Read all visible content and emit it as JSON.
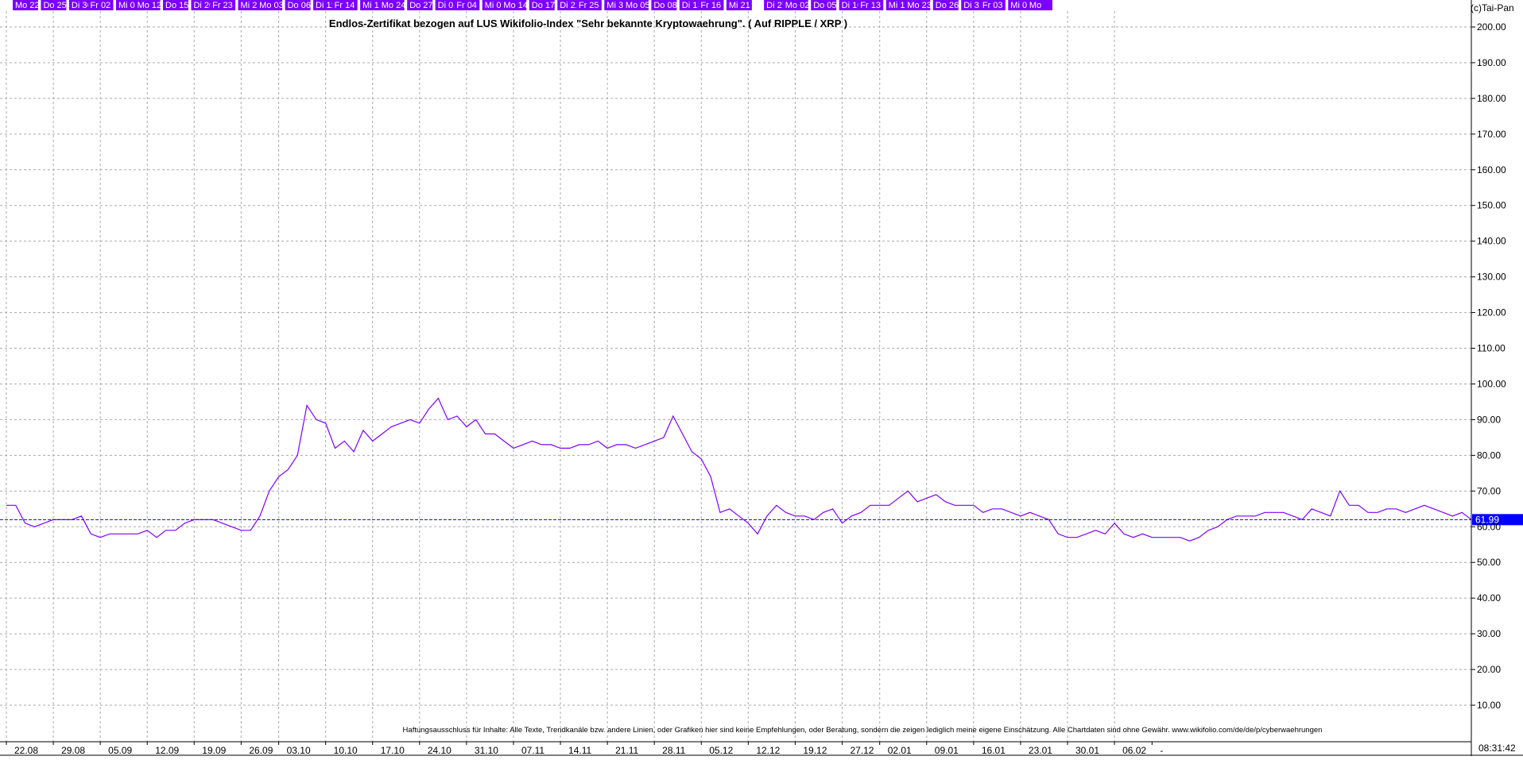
{
  "chart_data": {
    "type": "line",
    "title": "Endlos-Zertifikat bezogen auf LUS Wikifolio-Index \"Sehr bekannte Kryptowaehrung\". ( Auf RIPPLE / XRP )",
    "copyright": "(c)Tai-Pan",
    "disclaimer": "Haftungsausschluss für Inhalte: Alle Texte, Trendkanäle bzw. andere Linien, oder Grafiken hier sind keine Empfehlungen, oder Beratung, sondern die zeigen lediglich meine eigene Einschätzung. Alle Chartdaten sind ohne Gewähr. www.wikifolio.com/de/de/p/cyberwaehrungen",
    "time_label": "08:31:42",
    "ylim": [
      0,
      210
    ],
    "y_ticks": [
      "10.00",
      "20.00",
      "30.00",
      "40.00",
      "50.00",
      "60.00",
      "70.00",
      "80.00",
      "90.00",
      "100.00",
      "110.00",
      "120.00",
      "130.00",
      "140.00",
      "150.00",
      "160.00",
      "170.00",
      "180.00",
      "190.00",
      "200.00"
    ],
    "y_tick_values": [
      10,
      20,
      30,
      40,
      50,
      60,
      70,
      80,
      90,
      100,
      110,
      120,
      130,
      140,
      150,
      160,
      170,
      180,
      190,
      200
    ],
    "x_dates": [
      "22.08",
      "29.08",
      "05.09",
      "12.09",
      "19.09",
      "26.09",
      "03.10",
      "10.10",
      "17.10",
      "24.10",
      "31.10",
      "07.11",
      "14.11",
      "21.11",
      "28.11",
      "05.12",
      "12.12",
      "19.12",
      "27.12",
      "02.01",
      "09.01",
      "16.01",
      "23.01",
      "30.01",
      "06.02",
      "-"
    ],
    "x_date_index": [
      0,
      5,
      10,
      15,
      20,
      25,
      29,
      34,
      39,
      44,
      49,
      54,
      59,
      64,
      69,
      74,
      79,
      84,
      89,
      93,
      98,
      103,
      108,
      113,
      118,
      122
    ],
    "x_days": [
      "Mo 22",
      "Do 25",
      "Di 30",
      "Fr 02",
      "Mi 07",
      "Mo 12",
      "Do 15",
      "Di 20",
      "Fr 23",
      "Mi 28",
      "Mo 03",
      "Do 06",
      "Di 11",
      "Fr 14",
      "Mi 19",
      "Mo 24",
      "Do 27",
      "Di 01",
      "Fr 04",
      "Mi 09",
      "Mo 14",
      "Do 17",
      "Di 22",
      "Fr 25",
      "Mi 30",
      "Mo 05",
      "Do 08",
      "Di 13",
      "Fr 16",
      "Mi 21",
      "Di 27",
      "Mo 02",
      "Do 05",
      "Di 10",
      "Fr 13",
      "Mi 18",
      "Mo 23",
      "Do 26",
      "Di 31",
      "Fr 03",
      "Mi 08",
      "Mo"
    ],
    "x_day_index": [
      0,
      3,
      6,
      8,
      11,
      13,
      16,
      19,
      21,
      24,
      26,
      29,
      32,
      34,
      37,
      39,
      42,
      45,
      47,
      50,
      52,
      55,
      58,
      60,
      63,
      65,
      68,
      71,
      73,
      76,
      80,
      82,
      85,
      88,
      90,
      93,
      95,
      98,
      101,
      103,
      106,
      108
    ],
    "last_value_label": "61.99",
    "last_value": 61.99,
    "colors": {
      "line": "#7f00ff",
      "header": "#7b00ff",
      "current": "#0000ff",
      "grid": "#aaaaaa"
    },
    "series": [
      {
        "values": [
          66,
          66,
          61,
          60,
          61,
          62,
          62,
          62,
          63,
          58,
          57,
          58,
          58,
          58,
          58,
          59,
          57,
          59,
          59,
          61,
          62,
          62,
          62,
          61,
          60,
          59,
          59,
          63,
          70,
          74,
          76,
          80,
          94,
          90,
          89,
          82,
          84,
          81,
          87,
          84,
          86,
          88,
          89,
          90,
          89,
          93,
          96,
          90,
          91,
          88,
          90,
          86,
          86,
          84,
          82,
          83,
          84,
          83,
          83,
          82,
          82,
          83,
          83,
          84,
          82,
          83,
          83,
          82,
          83,
          84,
          85,
          91,
          86,
          81,
          79,
          74,
          64,
          65,
          63,
          61,
          58,
          63,
          66,
          64,
          63,
          63,
          62,
          64,
          65,
          61,
          63,
          64,
          66,
          66,
          66,
          68,
          70,
          67,
          68,
          69,
          67,
          66,
          66,
          66,
          64,
          65,
          65,
          64,
          63,
          64,
          63,
          62,
          58,
          57,
          57,
          58,
          59,
          58,
          61,
          58,
          57,
          58,
          57,
          57,
          57,
          57,
          56,
          57,
          59,
          60,
          62,
          63,
          63,
          63,
          64,
          64,
          64,
          63,
          62,
          65,
          64,
          63,
          70,
          66,
          66,
          64,
          64,
          65,
          65,
          64,
          65,
          66,
          65,
          64,
          63,
          64,
          62
        ]
      }
    ]
  }
}
